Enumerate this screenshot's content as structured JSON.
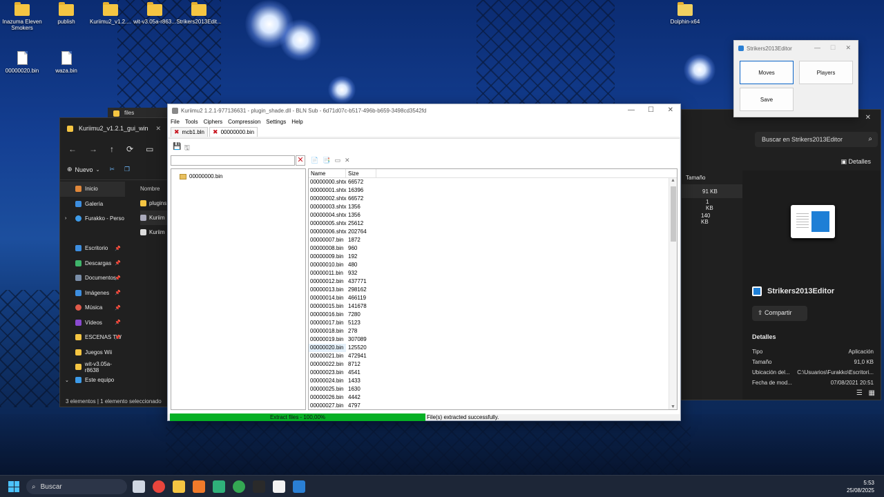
{
  "desktop": {
    "icons": [
      {
        "label": "Inazuma Eleven Smokers",
        "type": "folder"
      },
      {
        "label": "publish",
        "type": "folder"
      },
      {
        "label": "Kuriimu2_v1.2....",
        "type": "folder"
      },
      {
        "label": "wit-v3.05a-r863...",
        "type": "folder"
      },
      {
        "label": "Strikers2013Edit...",
        "type": "folder"
      },
      {
        "label": "Dolphin-x64",
        "type": "app"
      },
      {
        "label": "00000020.bin",
        "type": "file"
      },
      {
        "label": "waza.bin",
        "type": "file"
      }
    ],
    "background_window_label": "files"
  },
  "explorer": {
    "title": "Kuriimu2_v1.2.1_gui_win",
    "new_label": "Nuevo",
    "sidebar": [
      {
        "label": "Inicio",
        "icon": "home-icon",
        "color": "#e0873a",
        "pinned": false
      },
      {
        "label": "Galería",
        "icon": "gallery-icon",
        "color": "#3d8ee0",
        "pinned": false
      },
      {
        "label": "Furakko - Perso",
        "icon": "cloud-icon",
        "color": "#3d9be9",
        "pinned": false
      },
      {
        "label": "Escritorio",
        "icon": "desktop-icon",
        "color": "#3d8ee0",
        "pinned": true
      },
      {
        "label": "Descargas",
        "icon": "download-icon",
        "color": "#3fb56b",
        "pinned": true
      },
      {
        "label": "Documentos",
        "icon": "documents-icon",
        "color": "#7a8ea8",
        "pinned": true
      },
      {
        "label": "Imágenes",
        "icon": "images-icon",
        "color": "#3d8ee0",
        "pinned": true
      },
      {
        "label": "Música",
        "icon": "music-icon",
        "color": "#e05a4a",
        "pinned": true
      },
      {
        "label": "Vídeos",
        "icon": "videos-icon",
        "color": "#8a4ad0",
        "pinned": true
      },
      {
        "label": "ESCENAS TW",
        "icon": "folder-icon",
        "color": "#f5c542",
        "pinned": true
      },
      {
        "label": "Juegos Wii",
        "icon": "folder-icon",
        "color": "#f5c542",
        "pinned": false
      },
      {
        "label": "wit-v3.05a-r8638",
        "icon": "folder-icon",
        "color": "#f5c542",
        "pinned": false
      },
      {
        "label": "Este equipo",
        "icon": "computer-icon",
        "color": "#3d9be9",
        "pinned": false
      }
    ],
    "column_name": "Nombre",
    "files": [
      {
        "label": "plugins",
        "icon": "folder-icon"
      },
      {
        "label": "Kuriim",
        "icon": "app-icon"
      },
      {
        "label": "Kuriim",
        "icon": "file-icon"
      }
    ],
    "status_count": "3 elementos",
    "status_selected": "1 elemento seleccionado"
  },
  "right_panel": {
    "search_placeholder": "Buscar en Strikers2013Editor",
    "details_button": "Detalles",
    "size_header": "Tamaño",
    "sizes": [
      "91 KB",
      "1 KB",
      "140 KB"
    ],
    "selected_name": "Strikers2013Editor",
    "share_label": "Compartir",
    "details_title": "Detalles",
    "details": [
      {
        "key": "Tipo",
        "value": "Aplicación"
      },
      {
        "key": "Tamaño",
        "value": "91,0 KB"
      },
      {
        "key": "Ubicación del...",
        "value": "C:\\Usuarios\\Furakko\\Escritori..."
      },
      {
        "key": "Fecha de mod...",
        "value": "07/08/2021 20:51"
      }
    ]
  },
  "strikers": {
    "title": "Strikers2013Editor",
    "buttons": {
      "moves": "Moves",
      "players": "Players",
      "save": "Save"
    }
  },
  "kuriimu": {
    "title": "Kuriimu2 1.2.1-977136631 - plugin_shade.dll - BLN Sub - 6d71d07c-b517-496b-b659-3498cd3542fd",
    "menu": [
      "File",
      "Tools",
      "Ciphers",
      "Compression",
      "Settings",
      "Help"
    ],
    "tabs": [
      {
        "label": "mcb1.bln"
      },
      {
        "label": "00000000.bin"
      }
    ],
    "tree_root": "00000000.bin",
    "columns": {
      "name": "Name",
      "size": "Size"
    },
    "files": [
      {
        "name": "00000000.shtx",
        "size": "66572"
      },
      {
        "name": "00000001.shtx",
        "size": "16396"
      },
      {
        "name": "00000002.shtx",
        "size": "66572"
      },
      {
        "name": "00000003.shtx",
        "size": "1356"
      },
      {
        "name": "00000004.shtx",
        "size": "1356"
      },
      {
        "name": "00000005.shtx",
        "size": "25612"
      },
      {
        "name": "00000006.shtx",
        "size": "202764"
      },
      {
        "name": "00000007.bin",
        "size": "1872"
      },
      {
        "name": "00000008.bin",
        "size": "960"
      },
      {
        "name": "00000009.bin",
        "size": "192"
      },
      {
        "name": "00000010.bin",
        "size": "480"
      },
      {
        "name": "00000011.bin",
        "size": "932"
      },
      {
        "name": "00000012.bin",
        "size": "437771"
      },
      {
        "name": "00000013.bin",
        "size": "298162"
      },
      {
        "name": "00000014.bin",
        "size": "466119"
      },
      {
        "name": "00000015.bin",
        "size": "141678"
      },
      {
        "name": "00000016.bin",
        "size": "7280"
      },
      {
        "name": "00000017.bin",
        "size": "5123"
      },
      {
        "name": "00000018.bin",
        "size": "278"
      },
      {
        "name": "00000019.bin",
        "size": "307089"
      },
      {
        "name": "00000020.bin",
        "size": "125520"
      },
      {
        "name": "00000021.bin",
        "size": "472941"
      },
      {
        "name": "00000022.bin",
        "size": "8712"
      },
      {
        "name": "00000023.bin",
        "size": "4541"
      },
      {
        "name": "00000024.bin",
        "size": "1433"
      },
      {
        "name": "00000025.bin",
        "size": "1630"
      },
      {
        "name": "00000026.bin",
        "size": "4442"
      },
      {
        "name": "00000027.bin",
        "size": "4797"
      }
    ],
    "selected_row": 20,
    "progress_label": "Extract files - 100,00%",
    "progress_fraction": 1.0,
    "status_message": "File(s) extracted successfully.",
    "progress_color": "#06b025"
  },
  "taskbar": {
    "search_label": "Buscar",
    "time": "5:53",
    "date": "25/08/2025",
    "apps": [
      {
        "icon": "task-view-icon",
        "color": "#cfd6e2"
      },
      {
        "icon": "chrome-icon",
        "color": "#e8453c"
      },
      {
        "icon": "file-explorer-icon",
        "color": "#f5c542"
      },
      {
        "icon": "app-a-icon",
        "color": "#f07a2a"
      },
      {
        "icon": "app-green-icon",
        "color": "#2fb07a"
      },
      {
        "icon": "chrome-active-icon",
        "color": "#34a853"
      },
      {
        "icon": "terminal-icon",
        "color": "#2a2a2a"
      },
      {
        "icon": "app-cat-icon",
        "color": "#f2f2f2"
      },
      {
        "icon": "strikers-icon",
        "color": "#2a7fd4"
      }
    ]
  }
}
